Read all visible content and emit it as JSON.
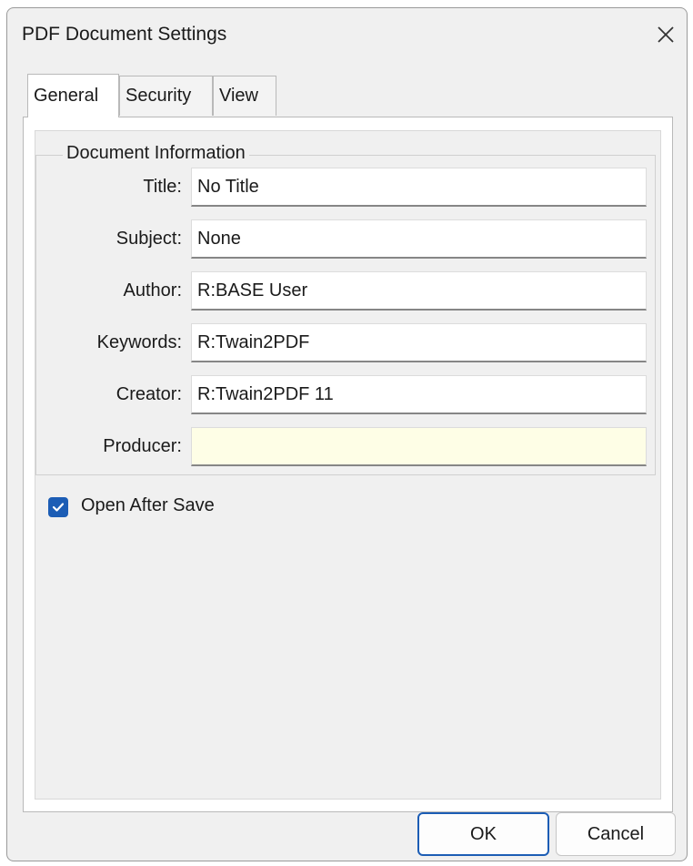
{
  "window": {
    "title": "PDF Document Settings",
    "close_icon": "close-icon"
  },
  "tabs": [
    {
      "label": "General",
      "active": true
    },
    {
      "label": "Security",
      "active": false
    },
    {
      "label": "View",
      "active": false
    }
  ],
  "group": {
    "legend": "Document Information"
  },
  "fields": [
    {
      "label": "Title:",
      "value": "No Title"
    },
    {
      "label": "Subject:",
      "value": "None"
    },
    {
      "label": "Author:",
      "value": "R:BASE User"
    },
    {
      "label": "Keywords:",
      "value": "R:Twain2PDF"
    },
    {
      "label": "Creator:",
      "value": "R:Twain2PDF 11"
    },
    {
      "label": "Producer:",
      "value": ""
    }
  ],
  "open_after_save": {
    "label": "Open After Save",
    "checked": true
  },
  "buttons": {
    "ok": "OK",
    "cancel": "Cancel"
  },
  "colors": {
    "accent": "#1c5db5",
    "producer_field": "#fefee6",
    "dialog_bg": "#f0f0f0"
  }
}
